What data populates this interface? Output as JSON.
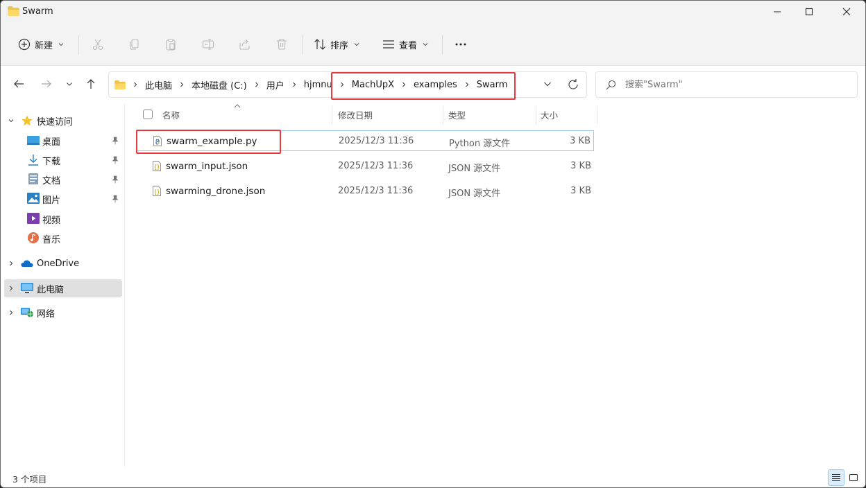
{
  "window": {
    "title": "Swarm",
    "accent": "#0067c0",
    "highlight_color": "#e5393f"
  },
  "toolbar": {
    "new_label": "新建",
    "sort_label": "排序",
    "view_label": "查看",
    "more_label": "···"
  },
  "address": {
    "crumbs": [
      "此电脑",
      "本地磁盘 (C:)",
      "用户",
      "hjmnu",
      "MachUpX",
      "examples",
      "Swarm"
    ]
  },
  "search": {
    "placeholder": "搜索\"Swarm\""
  },
  "sidebar": {
    "quick_access": "快速访问",
    "items": [
      {
        "label": "桌面",
        "icon": "desktop-icon"
      },
      {
        "label": "下载",
        "icon": "download-icon"
      },
      {
        "label": "文档",
        "icon": "documents-icon"
      },
      {
        "label": "图片",
        "icon": "pictures-icon"
      },
      {
        "label": "视频",
        "icon": "videos-icon"
      },
      {
        "label": "音乐",
        "icon": "music-icon"
      }
    ],
    "onedrive": "OneDrive",
    "this_pc": "此电脑",
    "network": "网络"
  },
  "columns": {
    "name": "名称",
    "modified": "修改日期",
    "type": "类型",
    "size": "大小"
  },
  "files": [
    {
      "name": "swarm_example.py",
      "modified": "2025/12/3 11:36",
      "type": "Python 源文件",
      "size": "3 KB",
      "icon": "python-file-icon"
    },
    {
      "name": "swarm_input.json",
      "modified": "2025/12/3 11:36",
      "type": "JSON 源文件",
      "size": "3 KB",
      "icon": "json-file-icon"
    },
    {
      "name": "swarming_drone.json",
      "modified": "2025/12/3 11:36",
      "type": "JSON 源文件",
      "size": "3 KB",
      "icon": "json-file-icon"
    }
  ],
  "status": {
    "item_count": "3 个项目"
  }
}
